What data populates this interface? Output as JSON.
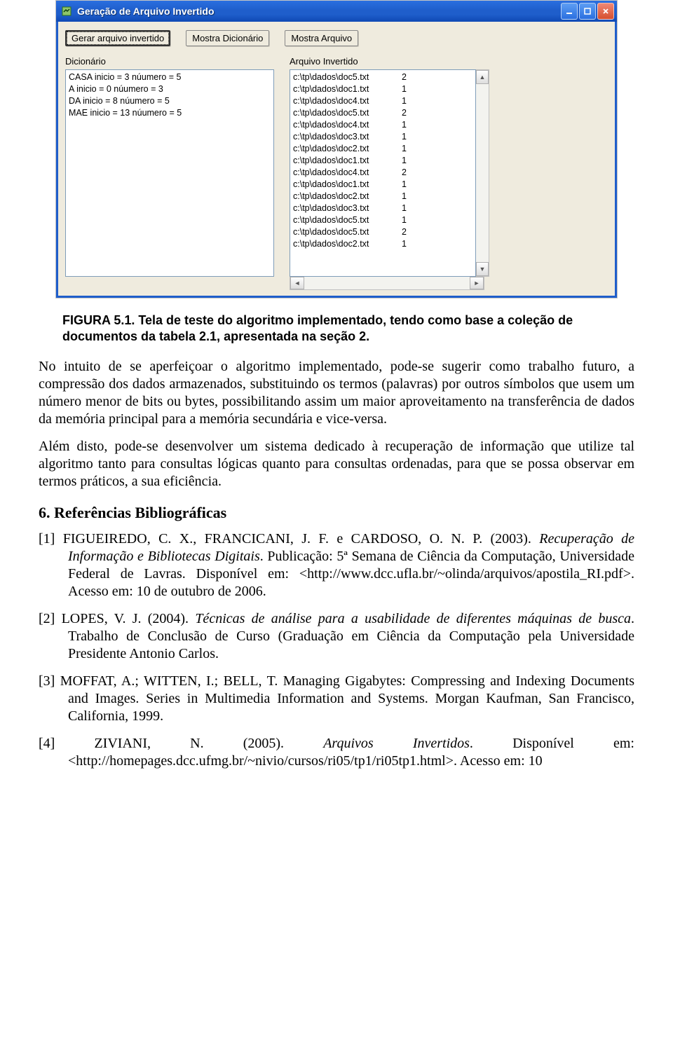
{
  "window": {
    "title": "Geração de Arquivo Invertido",
    "buttons": {
      "generate": "Gerar arquivo invertido",
      "showDict": "Mostra Dicionário",
      "showFile": "Mostra Arquivo"
    },
    "labels": {
      "dict": "Dicionário",
      "inverted": "Arquivo Invertido"
    },
    "dict_rows": [
      "CASA  inicio = 3  núumero = 5",
      "A  inicio = 0  núumero = 3",
      "DA  inicio = 8  núumero = 5",
      "MAE  inicio = 13  núumero = 5"
    ],
    "inverted_rows": [
      {
        "path": "c:\\tp\\dados\\doc5.txt",
        "count": "2"
      },
      {
        "path": "c:\\tp\\dados\\doc1.txt",
        "count": "1"
      },
      {
        "path": "c:\\tp\\dados\\doc4.txt",
        "count": "1"
      },
      {
        "path": "c:\\tp\\dados\\doc5.txt",
        "count": "2"
      },
      {
        "path": "c:\\tp\\dados\\doc4.txt",
        "count": "1"
      },
      {
        "path": "c:\\tp\\dados\\doc3.txt",
        "count": "1"
      },
      {
        "path": "c:\\tp\\dados\\doc2.txt",
        "count": "1"
      },
      {
        "path": "c:\\tp\\dados\\doc1.txt",
        "count": "1"
      },
      {
        "path": "c:\\tp\\dados\\doc4.txt",
        "count": "2"
      },
      {
        "path": "c:\\tp\\dados\\doc1.txt",
        "count": "1"
      },
      {
        "path": "c:\\tp\\dados\\doc2.txt",
        "count": "1"
      },
      {
        "path": "c:\\tp\\dados\\doc3.txt",
        "count": "1"
      },
      {
        "path": "c:\\tp\\dados\\doc5.txt",
        "count": "1"
      },
      {
        "path": "c:\\tp\\dados\\doc5.txt",
        "count": "2"
      },
      {
        "path": "c:\\tp\\dados\\doc2.txt",
        "count": "1"
      }
    ]
  },
  "caption": "FIGURA 5.1. Tela de teste do algoritmo implementado, tendo como base a coleção de documentos da tabela 2.1, apresentada na seção 2.",
  "paragraphs": {
    "p1": "No intuito de se aperfeiçoar o algoritmo implementado, pode-se sugerir como trabalho futuro, a compressão dos dados armazenados, substituindo os termos (palavras) por outros símbolos que usem um número menor de bits ou bytes, possibilitando assim um maior aproveitamento na transferência de dados da memória principal para a memória secundária e vice-versa.",
    "p2": "Além disto, pode-se desenvolver um sistema dedicado à recuperação de informação que utilize tal algoritmo tanto para consultas lógicas quanto para consultas ordenadas, para que se possa observar em termos práticos, a sua eficiência."
  },
  "heading": "6. Referências Bibliográficas",
  "refs": {
    "r1_a": "[1] FIGUEIREDO, C. X., FRANCICANI, J. F. e CARDOSO, O. N. P. (2003). ",
    "r1_i": "Recuperação de Informação e Bibliotecas Digitais",
    "r1_b": ". Publicação: 5ª Semana de Ciência da Computação, Universidade Federal de Lavras. Disponível em: <http://www.dcc.ufla.br/~olinda/arquivos/apostila_RI.pdf>. Acesso em: 10 de outubro de 2006.",
    "r2_a": "[2] LOPES, V. J. (2004). ",
    "r2_i": "Técnicas de análise para a usabilidade de diferentes máquinas de busca",
    "r2_b": ". Trabalho de Conclusão de Curso (Graduação em Ciência da Computação pela Universidade Presidente Antonio Carlos.",
    "r3": "[3] MOFFAT, A.; WITTEN, I.; BELL, T. Managing Gigabytes: Compressing and Indexing Documents and Images. Series in Multimedia Information and Systems. Morgan Kaufman, San Francisco, California, 1999.",
    "r4_a": "[4] ZIVIANI, N. (2005). ",
    "r4_i": "Arquivos Invertidos",
    "r4_b": ". Disponível em: <http://homepages.dcc.ufmg.br/~nivio/cursos/ri05/tp1/ri05tp1.html>. Acesso em: 10"
  }
}
